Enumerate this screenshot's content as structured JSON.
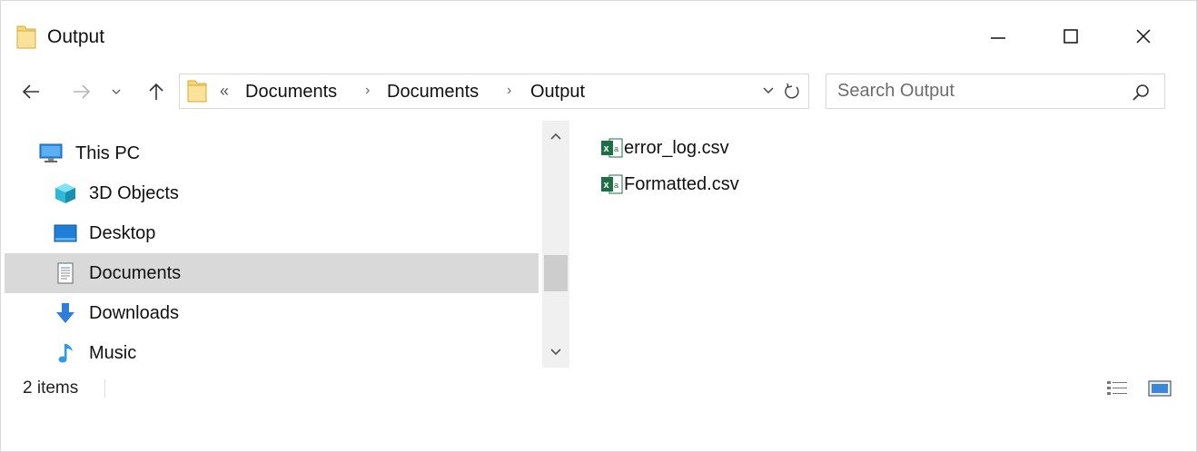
{
  "window": {
    "title": "Output",
    "controls": {
      "minimize": "—",
      "maximize": "☐",
      "close": "✕"
    }
  },
  "address_bar": {
    "overflow": "«",
    "breadcrumbs": [
      "Documents",
      "Documents",
      "Output"
    ],
    "separator": "›"
  },
  "search": {
    "placeholder": "Search Output"
  },
  "nav_pane": {
    "items": [
      {
        "label": "This PC",
        "icon": "computer-icon",
        "selected": false
      },
      {
        "label": "3D Objects",
        "icon": "cube-icon",
        "selected": false
      },
      {
        "label": "Desktop",
        "icon": "desktop-icon",
        "selected": false
      },
      {
        "label": "Documents",
        "icon": "document-icon",
        "selected": true
      },
      {
        "label": "Downloads",
        "icon": "download-arrow-icon",
        "selected": false
      },
      {
        "label": "Music",
        "icon": "music-note-icon",
        "selected": false
      }
    ]
  },
  "files": [
    {
      "name": "error_log.csv",
      "icon": "excel-csv-icon"
    },
    {
      "name": "Formatted.csv",
      "icon": "excel-csv-icon"
    }
  ],
  "status_bar": {
    "item_count": "2 items"
  },
  "colors": {
    "folder_yellow": "#f8d775",
    "selection_gray": "#d9d9d9",
    "excel_green": "#1d7044",
    "accent_blue": "#2f7fd8"
  }
}
